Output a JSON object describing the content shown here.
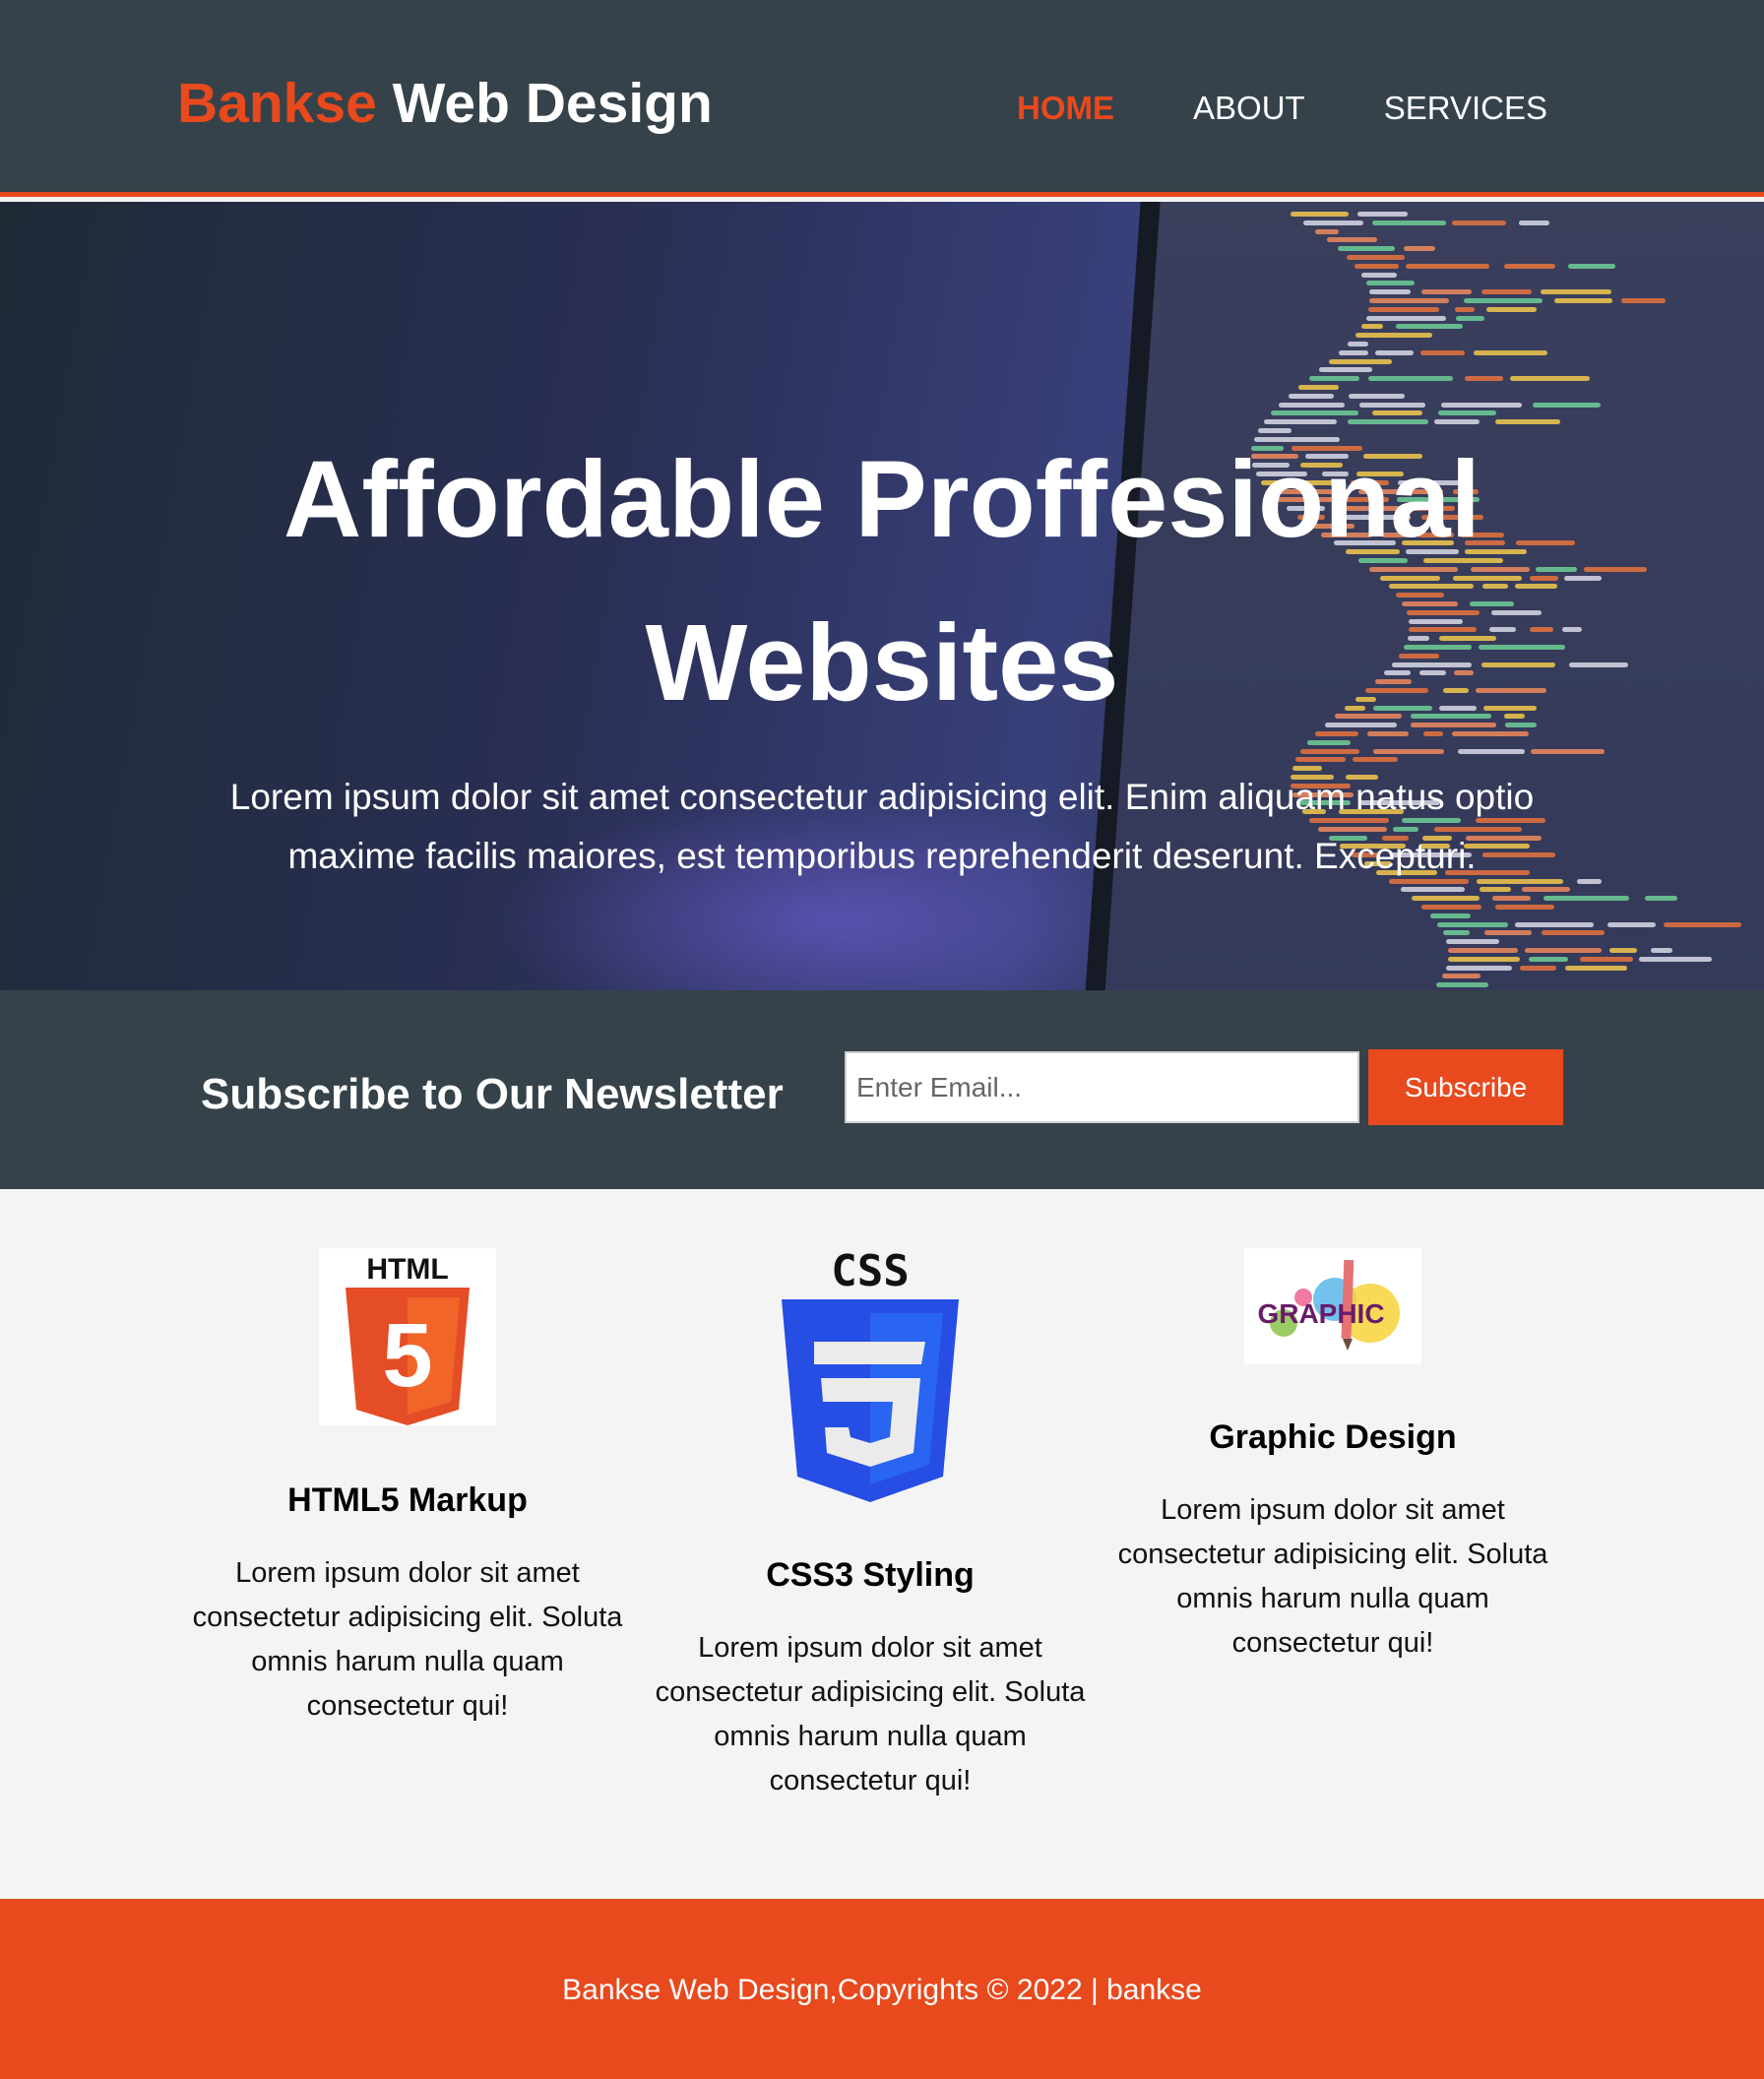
{
  "header": {
    "brand_highlight": "Bankse",
    "brand_rest": "Web Design",
    "nav": [
      {
        "label": "HOME"
      },
      {
        "label": "ABOUT"
      },
      {
        "label": "SERVICES"
      }
    ]
  },
  "hero": {
    "title_line1": "Affordable Proffesional",
    "title_line2": "Websites",
    "text": "Lorem ipsum dolor sit amet consectetur adipisicing elit. Enim aliquam natus optio maxime facilis maiores, est temporibus reprehenderit deserunt. Excepturi."
  },
  "newsletter": {
    "heading": "Subscribe to Our Newsletter",
    "email_placeholder": "Enter Email...",
    "button_label": "Subscribe"
  },
  "boxes": [
    {
      "logo_text": "HTML",
      "badge": "5",
      "title": "HTML5 Markup",
      "text": "Lorem ipsum dolor sit amet consectetur adipisicing elit. Soluta omnis harum nulla quam consectetur qui!"
    },
    {
      "logo_text": "CSS",
      "badge": "3",
      "title": "CSS3 Styling",
      "text": "Lorem ipsum dolor sit amet consectetur adipisicing elit. Soluta omnis harum nulla quam consectetur qui!"
    },
    {
      "logo_text": "GRAPHIC",
      "title": "Graphic Design",
      "text": "Lorem ipsum dolor sit amet consectetur adipisicing elit. Soluta omnis harum nulla quam consectetur qui!"
    }
  ],
  "footer": {
    "text": "Bankse Web Design,Copyrights © 2022 | bankse"
  },
  "colors": {
    "accent": "#e8491d",
    "dark": "#35424a",
    "light_bg": "#f4f4f4"
  },
  "icons": [
    "html5-logo-icon",
    "css3-logo-icon",
    "graphic-logo-icon"
  ]
}
